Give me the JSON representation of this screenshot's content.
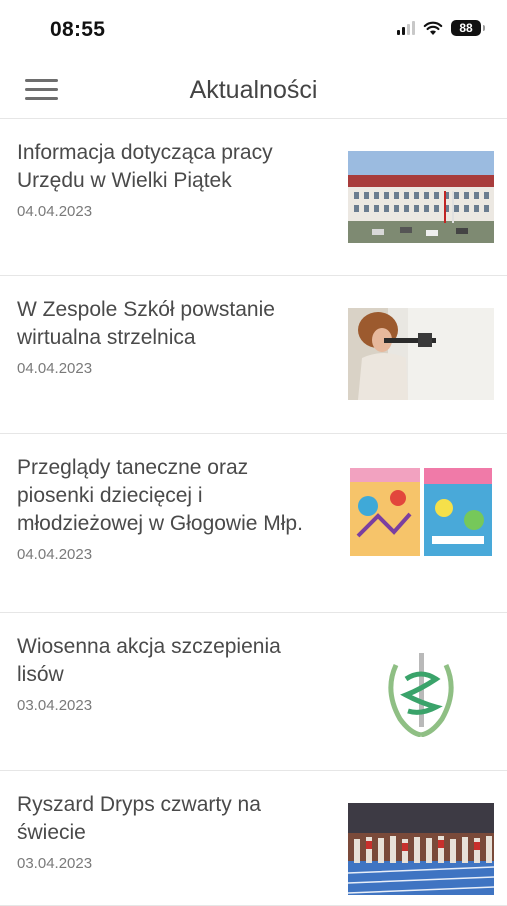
{
  "status_bar": {
    "time": "08:55",
    "battery": "88"
  },
  "header": {
    "title": "Aktualności"
  },
  "news": [
    {
      "title": "Informacja dotycząca pracy Urzędu w Wielki Piątek",
      "date": "04.04.2023"
    },
    {
      "title": "W Zespole Szkół powstanie wirtualna strzelnica",
      "date": "04.04.2023"
    },
    {
      "title": "Przeglądy taneczne oraz piosenki dziecięcej i młodzieżowej w Głogowie Młp.",
      "date": "04.04.2023"
    },
    {
      "title": "Wiosenna akcja szczepienia lisów",
      "date": "03.04.2023"
    },
    {
      "title": "Ryszard Dryps czwarty na świecie",
      "date": "03.04.2023"
    }
  ]
}
